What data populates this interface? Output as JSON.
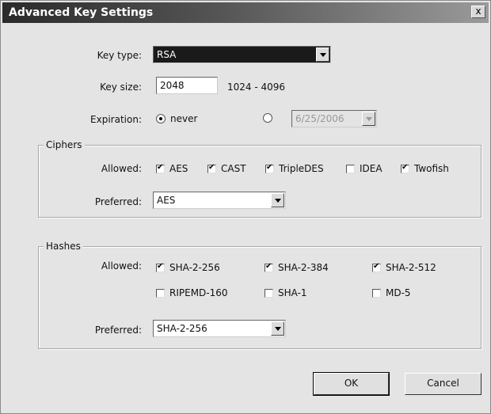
{
  "window": {
    "title": "Advanced Key Settings",
    "close_label": "x"
  },
  "key": {
    "type_label": "Key type:",
    "type_value": "RSA",
    "size_label": "Key size:",
    "size_value": "2048",
    "size_range": "1024 - 4096",
    "expiration_label": "Expiration:",
    "expiration_never": "never",
    "expiration_date": "6/25/2006"
  },
  "ciphers": {
    "group_title": "Ciphers",
    "allowed_label": "Allowed:",
    "items": [
      {
        "label": "AES",
        "checked": true
      },
      {
        "label": "CAST",
        "checked": true
      },
      {
        "label": "TripleDES",
        "checked": true
      },
      {
        "label": "IDEA",
        "checked": false
      },
      {
        "label": "Twofish",
        "checked": true
      }
    ],
    "preferred_label": "Preferred:",
    "preferred_value": "AES"
  },
  "hashes": {
    "group_title": "Hashes",
    "allowed_label": "Allowed:",
    "items": [
      {
        "label": "SHA-2-256",
        "checked": true
      },
      {
        "label": "SHA-2-384",
        "checked": true
      },
      {
        "label": "SHA-2-512",
        "checked": true
      },
      {
        "label": "RIPEMD-160",
        "checked": false
      },
      {
        "label": "SHA-1",
        "checked": false
      },
      {
        "label": "MD-5",
        "checked": false
      }
    ],
    "preferred_label": "Preferred:",
    "preferred_value": "SHA-2-256"
  },
  "buttons": {
    "ok": "OK",
    "cancel": "Cancel"
  }
}
